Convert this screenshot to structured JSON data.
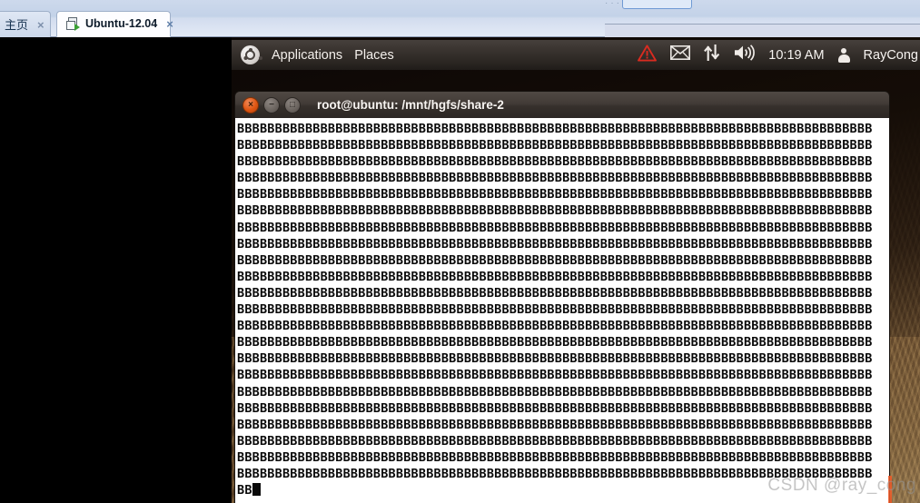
{
  "window": {
    "tabs": [
      {
        "label": "主页",
        "icon": "home-tab",
        "close": "×",
        "active": false
      },
      {
        "label": "Ubuntu-12.04",
        "icon": "virtual-machine-icon",
        "close": "×",
        "active": true
      }
    ]
  },
  "panel": {
    "logo_icon": "ubuntu-logo-icon",
    "menus": [
      "Applications",
      "Places"
    ],
    "applications_label": "Applications",
    "places_label": "Places",
    "indicators": [
      {
        "name": "warning-icon",
        "glyph": "⚠"
      },
      {
        "name": "mail-icon",
        "glyph": "✉"
      },
      {
        "name": "network-icon",
        "glyph": "⇅"
      },
      {
        "name": "volume-icon",
        "glyph": "🔊"
      }
    ],
    "clock": "10:19 AM",
    "user_icon": "user-icon",
    "user_name": "RayCong"
  },
  "terminal": {
    "title": "root@ubuntu: /mnt/hgfs/share-2",
    "buttons": {
      "close": "×",
      "minimize": "−",
      "maximize": "□"
    },
    "line_char": "B",
    "chars_per_line": 84,
    "full_lines": 22,
    "last_line": "BB",
    "cursor": "block-cursor"
  },
  "watermark": {
    "text": "CSDN @ray_cong",
    "accent_color": "#f05a28"
  },
  "colors": {
    "tabstrip": "#c9d6ea",
    "desktop_dark": "#1b1008",
    "terminal_bg": "#ffffff",
    "terminal_fg": "#0a0a0a",
    "panel_bg": "#37312d",
    "ubuntu_orange": "#df5612"
  }
}
